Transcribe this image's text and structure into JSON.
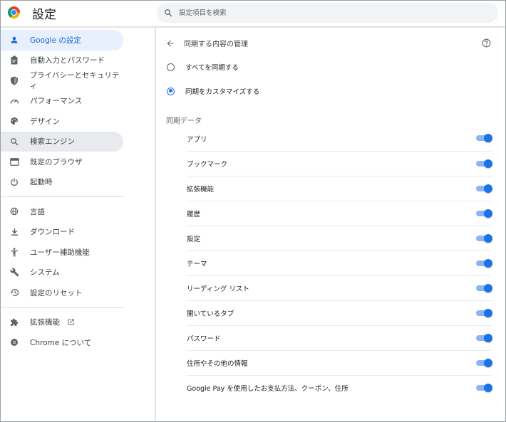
{
  "header": {
    "app_title": "設定",
    "search_placeholder": "設定項目を検索",
    "search_value": ""
  },
  "sidebar": {
    "items": [
      {
        "label": "Google の設定",
        "icon": "person-icon",
        "state": "active"
      },
      {
        "label": "自動入力とパスワード",
        "icon": "clipboard-icon",
        "state": ""
      },
      {
        "label": "プライバシーとセキュリティ",
        "icon": "shield-icon",
        "state": ""
      },
      {
        "label": "パフォーマンス",
        "icon": "speedometer-icon",
        "state": ""
      },
      {
        "label": "デザイン",
        "icon": "palette-icon",
        "state": ""
      },
      {
        "label": "検索エンジン",
        "icon": "search-icon",
        "state": "hover"
      },
      {
        "label": "既定のブラウザ",
        "icon": "browser-icon",
        "state": ""
      },
      {
        "label": "起動時",
        "icon": "power-icon",
        "state": ""
      }
    ],
    "items2": [
      {
        "label": "言語",
        "icon": "globe-icon"
      },
      {
        "label": "ダウンロード",
        "icon": "download-icon"
      },
      {
        "label": "ユーザー補助機能",
        "icon": "accessibility-icon"
      },
      {
        "label": "システム",
        "icon": "wrench-icon"
      },
      {
        "label": "設定のリセット",
        "icon": "restore-icon"
      }
    ],
    "items3": [
      {
        "label": "拡張機能",
        "icon": "puzzle-icon",
        "external": "open-in-new-icon"
      },
      {
        "label": "Chrome について",
        "icon": "chrome-icon"
      }
    ]
  },
  "main": {
    "title": "同期する内容の管理",
    "radio_options": [
      {
        "label": "すべてを同期する",
        "checked": false
      },
      {
        "label": "同期をカスタマイズする",
        "checked": true
      }
    ],
    "section_label": "同期データ",
    "toggles": [
      {
        "label": "アプリ",
        "on": true
      },
      {
        "label": "ブックマーク",
        "on": true
      },
      {
        "label": "拡張機能",
        "on": true
      },
      {
        "label": "履歴",
        "on": true
      },
      {
        "label": "設定",
        "on": true
      },
      {
        "label": "テーマ",
        "on": true
      },
      {
        "label": "リーディング リスト",
        "on": true
      },
      {
        "label": "開いているタブ",
        "on": true
      },
      {
        "label": "パスワード",
        "on": true
      },
      {
        "label": "住所やその他の情報",
        "on": true
      },
      {
        "label": "Google Pay を使用したお支払方法、クーポン、住所",
        "on": true
      }
    ]
  },
  "colors": {
    "accent": "#1a73e8",
    "active_bg": "#e8f0fe",
    "hover_bg": "#e8eaed",
    "toggle_track": "#8ab4f8"
  }
}
